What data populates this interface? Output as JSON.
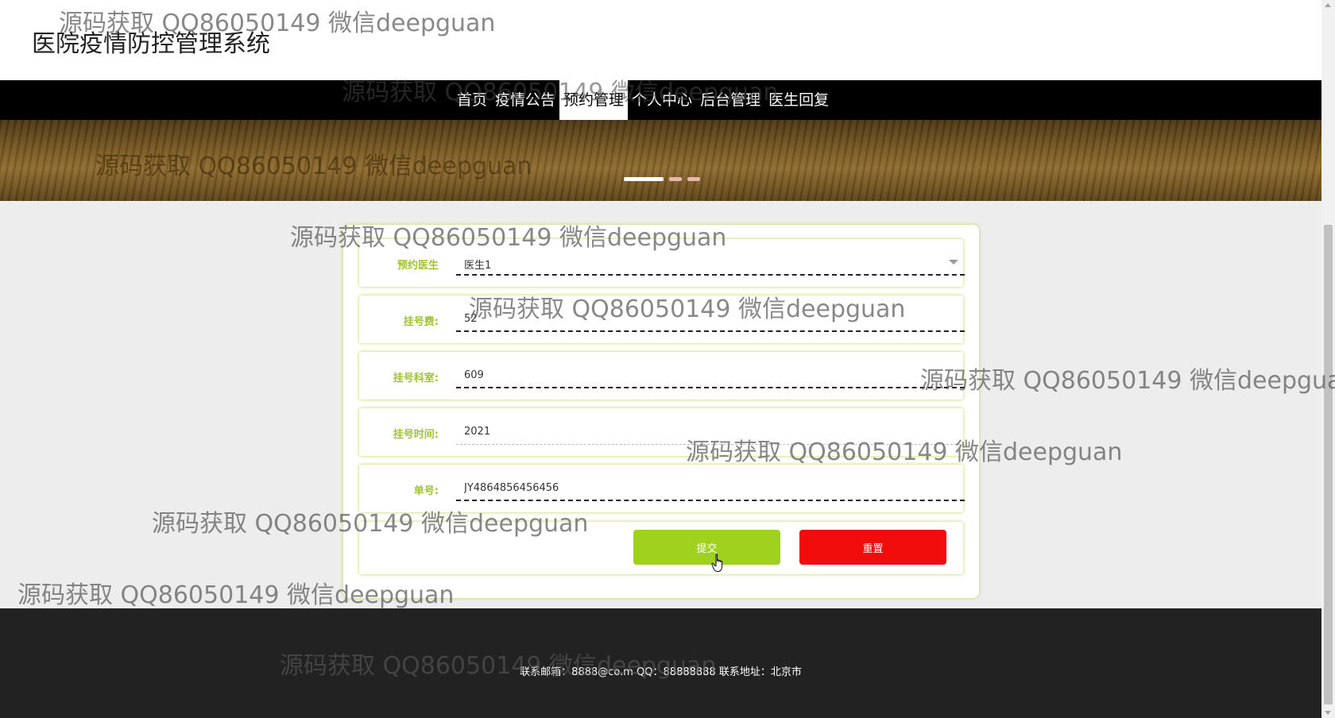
{
  "site": {
    "title": "医院疫情防控管理系统"
  },
  "nav": {
    "items": [
      {
        "label": "首页"
      },
      {
        "label": "疫情公告"
      },
      {
        "label": "预约管理"
      },
      {
        "label": "个人中心"
      },
      {
        "label": "后台管理"
      },
      {
        "label": "医生回复"
      }
    ],
    "active_index": 2
  },
  "banner": {
    "slide_count": 3,
    "active_slide": 1
  },
  "form": {
    "doctor_label": "预约医生",
    "doctor_value": "医生1",
    "fee_label": "挂号费:",
    "fee_value": "52",
    "dept_label": "挂号科室:",
    "dept_value": "609",
    "time_label": "挂号时间:",
    "time_value": "2021",
    "order_label": "单号:",
    "order_value": "JY4864856456456",
    "submit_label": "提交",
    "reset_label": "重置"
  },
  "footer": {
    "text": "联系邮箱：8888@co.m QQ：88888888 联系地址：北京市"
  },
  "watermark": {
    "text": "源码获取 QQ86050149 微信deepguan"
  },
  "colors": {
    "nav_bg": "#000000",
    "accent_green": "#a0d11f",
    "label_green": "#a0c333",
    "reset_red": "#f20d0d",
    "footer_bg": "#222222"
  }
}
